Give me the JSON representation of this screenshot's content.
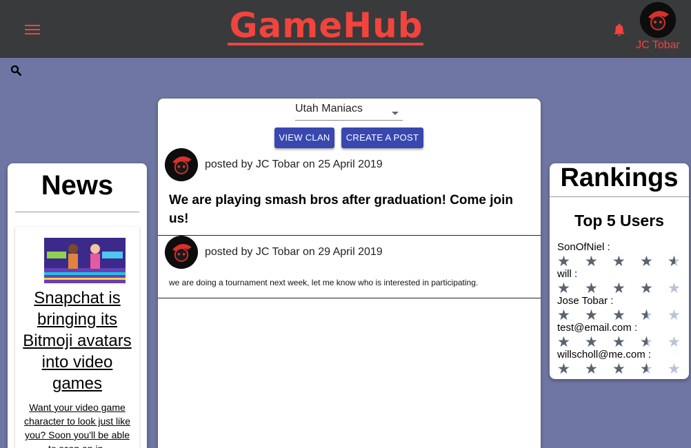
{
  "app": {
    "logo": "GameHub",
    "user": {
      "name": "JC Tobar"
    },
    "colors": {
      "header_bg": "#393a3c",
      "brand": "#f2443d",
      "page_bg": "#6f76a3",
      "primary_button": "#3848b0"
    }
  },
  "icons": {
    "menu": "menu-icon",
    "bell": "bell-icon",
    "search": "search-icon"
  },
  "news": {
    "title": "News",
    "item": {
      "headline": "Snapchat is bringing its Bitmoji avatars into video games",
      "summary": "Want your video game character to look just like you? Soon you'll be able to scan an in-"
    }
  },
  "feed": {
    "clan_select": {
      "value": "Utah Maniacs"
    },
    "buttons": {
      "view_clan": "VIEW CLAN",
      "create_post": "CREATE A POST"
    },
    "posts": [
      {
        "meta": "posted by JC Tobar on 25 April 2019",
        "body": "We are playing smash bros after graduation! Come join us!"
      },
      {
        "meta": "posted by JC Tobar on 29 April 2019",
        "body": "we are doing a tournament next week, let me know who is interested in participating."
      }
    ]
  },
  "rankings": {
    "title": "Rankings",
    "subtitle": "Top 5 Users",
    "users": [
      {
        "name": "SonOfNiel :",
        "rating": 4.5
      },
      {
        "name": "will :",
        "rating": 4
      },
      {
        "name": "Jose Tobar :",
        "rating": 3.5
      },
      {
        "name": "test@email.com :",
        "rating": 3.5
      },
      {
        "name": "willscholl@me.com :",
        "rating": 3.5
      }
    ],
    "max_rating": 5
  }
}
